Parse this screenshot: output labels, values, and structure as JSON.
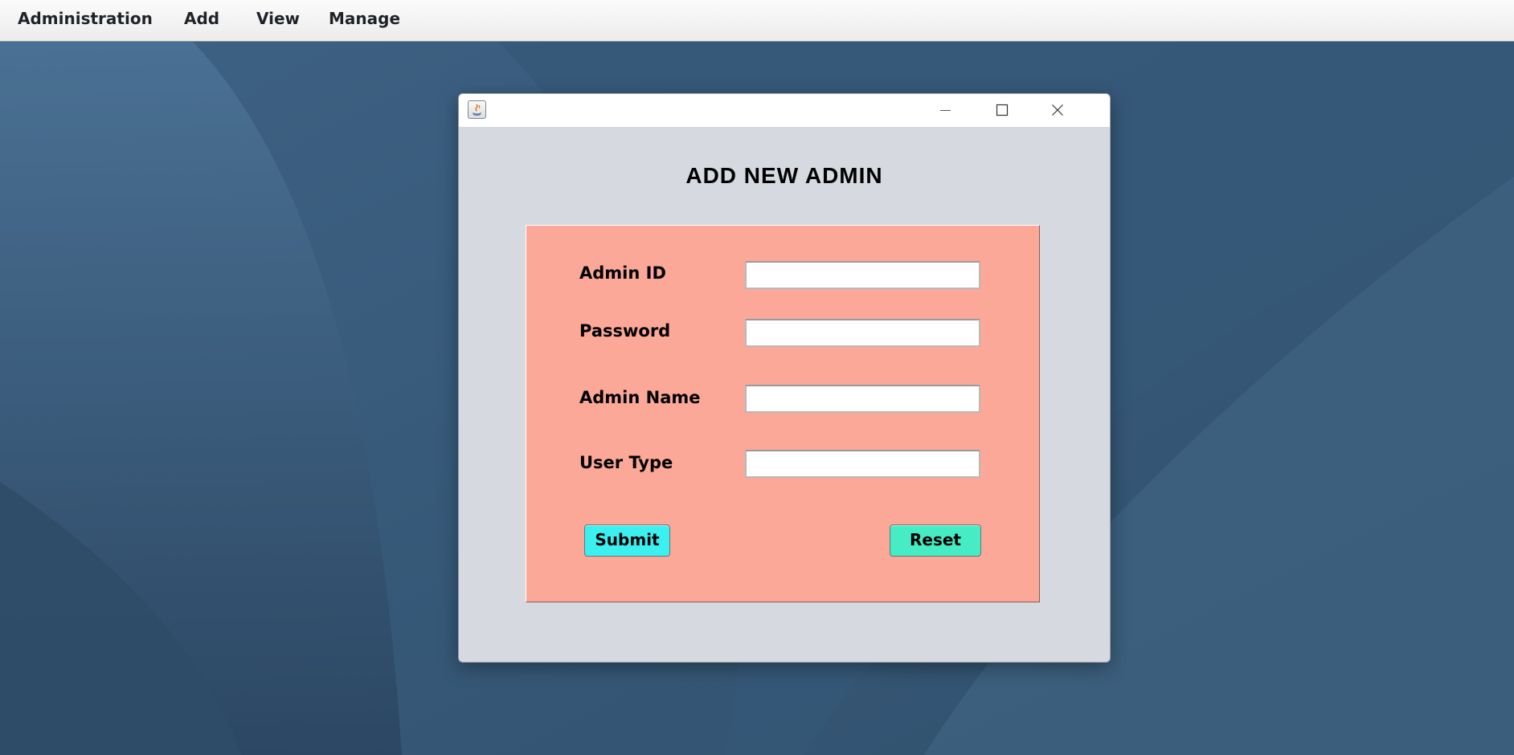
{
  "menubar": {
    "items": [
      {
        "label": "Administration"
      },
      {
        "label": "Add"
      },
      {
        "label": "View"
      },
      {
        "label": "Manage"
      }
    ]
  },
  "dialog": {
    "title": "ADD NEW ADMIN",
    "fields": [
      {
        "label": "Admin ID",
        "value": ""
      },
      {
        "label": "Password",
        "value": ""
      },
      {
        "label": "Admin Name",
        "value": ""
      },
      {
        "label": "User Type",
        "value": ""
      }
    ],
    "submit_label": "Submit",
    "reset_label": "Reset"
  },
  "colors": {
    "desktop": "#395a78",
    "panel": "#fca898",
    "window": "#d6d9e0",
    "submit_button": "#3cf0f0",
    "reset_button": "#45ecc4"
  },
  "icons": {
    "window_app": "java-icon",
    "minimize": "minimize-icon",
    "maximize": "maximize-icon",
    "close": "close-icon"
  }
}
